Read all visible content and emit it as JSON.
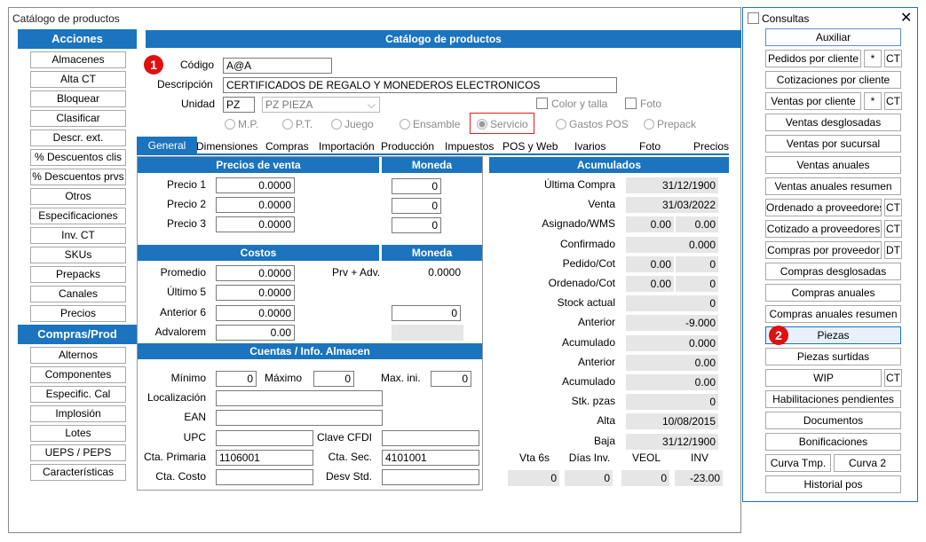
{
  "window": {
    "title": "Catálogo de productos"
  },
  "left": {
    "acciones_title": "Acciones",
    "acciones": [
      "Almacenes",
      "Alta CT",
      "Bloquear",
      "Clasificar",
      "Descr. ext.",
      "% Descuentos clis",
      "% Descuentos prvs",
      "Otros",
      "Especificaciones",
      "Inv. CT",
      "SKUs",
      "Prepacks",
      "Canales",
      "Precios"
    ],
    "compras_title": "Compras/Prod",
    "compras": [
      "Alternos",
      "Componentes",
      "Especific. Cal",
      "Implosión",
      "Lotes",
      "UEPS / PEPS",
      "Características"
    ]
  },
  "main": {
    "title": "Catálogo de productos",
    "codigo_label": "Código",
    "codigo": "A@A",
    "descripcion_label": "Descripción",
    "descripcion": "CERTIFICADOS DE REGALO Y MONEDEROS ELECTRONICOS",
    "unidad_label": "Unidad",
    "unidad": "PZ",
    "unidad_desc": "PZ  PIEZA",
    "color_talla": "Color y talla",
    "foto": "Foto",
    "radios": [
      "M.P.",
      "P.T.",
      "Juego",
      "Ensamble",
      "Servicio",
      "Gastos POS",
      "Prepack"
    ],
    "tabs": [
      "General",
      "Dimensiones",
      "Compras",
      "Importación",
      "Producción",
      "Impuestos",
      "POS y Web",
      "Ivarios",
      "Foto",
      "Precios"
    ]
  },
  "precios": {
    "title": "Precios de venta",
    "moneda_title": "Moneda",
    "rows": [
      {
        "label": "Precio 1",
        "value": "0.0000",
        "moneda": "0"
      },
      {
        "label": "Precio 2",
        "value": "0.0000",
        "moneda": "0"
      },
      {
        "label": "Precio 3",
        "value": "0.0000",
        "moneda": "0"
      }
    ]
  },
  "costos": {
    "title": "Costos",
    "moneda_title": "Moneda",
    "promedio_label": "Promedio",
    "promedio": "0.0000",
    "prv_adv_label": "Prv + Adv.",
    "prv_adv": "0.0000",
    "ultimo5_label": "Último 5",
    "ultimo5": "0.0000",
    "anterior6_label": "Anterior 6",
    "anterior6": "0.0000",
    "anterior6_moneda": "0",
    "advalorem_label": "Advalorem",
    "advalorem": "0.00"
  },
  "cuentas": {
    "title": "Cuentas / Info. Almacen",
    "minimo_label": "Mínimo",
    "minimo": "0",
    "maximo_label": "Máximo",
    "maximo": "0",
    "maxini_label": "Max. ini.",
    "maxini": "0",
    "localizacion_label": "Localización",
    "ean_label": "EAN",
    "upc_label": "UPC",
    "clave_cfdi_label": "Clave CFDI",
    "cta_primaria_label": "Cta. Primaria",
    "cta_primaria": "1106001",
    "cta_sec_label": "Cta. Sec.",
    "cta_sec": "4101001",
    "cta_costo_label": "Cta. Costo",
    "desv_std_label": "Desv Std."
  },
  "acumulados": {
    "title": "Acumulados",
    "rows": [
      {
        "label": "Última  Compra",
        "v1": "",
        "v2": "31/12/1900"
      },
      {
        "label": "Venta",
        "v1": "",
        "v2": "31/03/2022"
      },
      {
        "label": "Asignado/WMS",
        "v1": "0.00",
        "v2": "0.00"
      },
      {
        "label": "Confirmado",
        "v1": "",
        "v2": "0.000"
      },
      {
        "label": "Pedido/Cot",
        "v1": "0.00",
        "v2": "0"
      },
      {
        "label": "Ordenado/Cot",
        "v1": "0.00",
        "v2": "0"
      },
      {
        "label": "Stock actual",
        "v1": "",
        "v2": "0"
      },
      {
        "label": "Anterior",
        "v1": "",
        "v2": "-9.000"
      },
      {
        "label": "Acumulado",
        "v1": "",
        "v2": "0.000"
      },
      {
        "label": "Anterior",
        "v1": "",
        "v2": "0.00"
      },
      {
        "label": "Acumulado",
        "v1": "",
        "v2": "0.00"
      },
      {
        "label": "Stk. pzas",
        "v1": "",
        "v2": "0"
      },
      {
        "label": "Alta",
        "v1": "",
        "v2": "10/08/2015"
      },
      {
        "label": "Baja",
        "v1": "",
        "v2": "31/12/1900"
      }
    ],
    "foot_labels": [
      "Vta 6s",
      "Días Inv.",
      "VEOL",
      "INV"
    ],
    "foot_values": [
      "0",
      "0",
      "0",
      "-23.00"
    ]
  },
  "consultas": {
    "title": "Consultas",
    "buttons": [
      "Auxiliar",
      "Pedidos por cliente",
      "Cotizaciones por cliente",
      "Ventas por cliente",
      "Ventas desglosadas",
      "Ventas por sucursal",
      "Ventas anuales",
      "Ventas anuales resumen",
      "Ordenado a proveedores",
      "Cotizado a proveedores",
      "Compras por proveedor",
      "Compras desglosadas",
      "Compras anuales",
      "Compras anuales resumen",
      "Piezas",
      "Piezas surtidas",
      "WIP",
      "Habilitaciones pendientes",
      "Documentos",
      "Bonificaciones",
      "Curva Tmp.",
      "Curva 2",
      "Historial pos"
    ],
    "star": "*",
    "ct": "CT",
    "dt": "DT"
  },
  "badges": [
    "1",
    "2"
  ],
  "colors": {
    "accent": "#1b74bd",
    "badge": "#e01010"
  }
}
